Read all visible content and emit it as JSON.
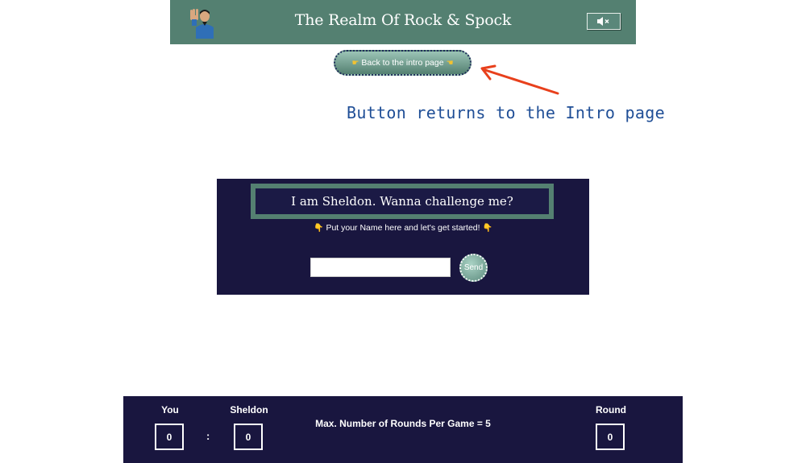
{
  "header": {
    "title": "The Realm Of Rock & Spock",
    "mute_icon": "speaker-muted-icon",
    "avatar": "spock-avatar"
  },
  "back_button": {
    "label": "Back to the intro page",
    "icon": "pointing-hand-icon"
  },
  "annotation": {
    "text": "Button returns to the Intro page",
    "color": "#1f4e96",
    "arrow_color": "#e8401c"
  },
  "card": {
    "title": "I am Sheldon. Wanna challenge me?",
    "instruction": "Put your Name here and let's get started!",
    "name_input": {
      "value": "",
      "placeholder": ""
    },
    "send_label": "Send"
  },
  "scoreboard": {
    "you_label": "You",
    "you_score": "0",
    "separator": ":",
    "sheldon_label": "Sheldon",
    "sheldon_score": "0",
    "max_rounds_text": "Max. Number of Rounds Per Game = 5",
    "round_label": "Round",
    "round_value": "0"
  },
  "colors": {
    "header_bg": "#548071",
    "card_bg": "#19163f",
    "accent": "#548071"
  }
}
